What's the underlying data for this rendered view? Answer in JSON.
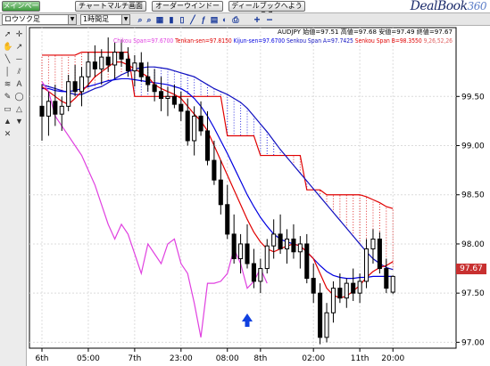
{
  "tabs": [
    {
      "label": "メインページ",
      "active": true
    },
    {
      "label": "チャートマルチ画面",
      "active": false
    },
    {
      "label": "オーダーウインドー",
      "active": false
    },
    {
      "label": "ディールブックへようこそ",
      "active": false
    }
  ],
  "logo": {
    "text": "DealBook",
    "num": "360"
  },
  "toolbar": {
    "chart_type": "ロウソク足",
    "timeframe": "1時間足",
    "icons": [
      "zoom-in-icon",
      "zoom-out-icon",
      "add-icon",
      "remove-icon"
    ]
  },
  "left_tools": [
    "cursor-icon",
    "crosshair-icon",
    "hand-icon",
    "arrow-icon",
    "trendline-icon",
    "hline-icon",
    "vline-icon",
    "channel-icon",
    "fib-icon",
    "text-icon",
    "pencil-icon",
    "ellipse-icon",
    "rect-icon",
    "triangle-icon",
    "arrow-up-icon",
    "arrow-down-icon",
    "delete-icon"
  ],
  "info": {
    "ohlc": "AUDJPY 始値=97.51 高値=97.68 安値=97.49 終値=97.67",
    "chikou": "Chikou Span=97.6700",
    "tenkan": "Tenkan-sen=97.8150",
    "kijun": "Kijun-sen=97.6700",
    "senkou_a": "Senkou Span A=97.7425",
    "senkou_b": "Senkou Span B=98.3550",
    "params": "9,26,52,26"
  },
  "colors": {
    "chikou": "#e040e0",
    "tenkan": "#e00000",
    "kijun": "#0000e0",
    "senkou_a": "#1010c0",
    "senkou_b": "#e00000",
    "price_tag": "#c83030",
    "signal_arrow": "#1040e0"
  },
  "last_price": "97.67",
  "chart_data": {
    "type": "candlestick",
    "symbol": "AUDJPY",
    "ylim": [
      96.94,
      100.2
    ],
    "y_ticks": [
      "97.00",
      "97.50",
      "98.00",
      "98.50",
      "99.00",
      "99.50"
    ],
    "x_ticks": [
      "6th",
      "05:00",
      "7th",
      "23:00",
      "08:00",
      "8th",
      "02:00",
      "11th",
      "20:00"
    ],
    "candles": [
      [
        99.4,
        99.62,
        99.05,
        99.3
      ],
      [
        99.3,
        99.55,
        99.1,
        99.45
      ],
      [
        99.45,
        99.62,
        99.2,
        99.32
      ],
      [
        99.32,
        99.5,
        99.15,
        99.4
      ],
      [
        99.4,
        99.72,
        99.35,
        99.65
      ],
      [
        99.65,
        99.82,
        99.5,
        99.55
      ],
      [
        99.55,
        99.8,
        99.4,
        99.7
      ],
      [
        99.7,
        99.95,
        99.6,
        99.85
      ],
      [
        99.85,
        100.02,
        99.7,
        99.78
      ],
      [
        99.78,
        99.98,
        99.62,
        99.9
      ],
      [
        99.9,
        100.1,
        99.75,
        99.82
      ],
      [
        99.82,
        100.05,
        99.68,
        99.95
      ],
      [
        99.95,
        100.08,
        99.8,
        99.88
      ],
      [
        99.88,
        100.0,
        99.7,
        99.76
      ],
      [
        99.76,
        99.92,
        99.6,
        99.84
      ],
      [
        99.84,
        99.95,
        99.65,
        99.7
      ],
      [
        99.7,
        99.85,
        99.55,
        99.62
      ],
      [
        99.62,
        99.78,
        99.45,
        99.55
      ],
      [
        99.55,
        99.7,
        99.35,
        99.48
      ],
      [
        99.48,
        99.6,
        99.3,
        99.5
      ],
      [
        99.5,
        99.62,
        99.38,
        99.42
      ],
      [
        99.42,
        99.55,
        99.25,
        99.35
      ],
      [
        99.35,
        99.48,
        99.0,
        99.05
      ],
      [
        99.05,
        99.4,
        98.9,
        99.3
      ],
      [
        99.3,
        99.45,
        99.1,
        99.15
      ],
      [
        99.15,
        99.35,
        98.8,
        98.85
      ],
      [
        98.85,
        99.05,
        98.6,
        98.65
      ],
      [
        98.65,
        98.85,
        98.3,
        98.4
      ],
      [
        98.4,
        98.6,
        98.05,
        98.1
      ],
      [
        98.1,
        98.3,
        97.8,
        97.85
      ],
      [
        97.85,
        98.1,
        97.7,
        98.0
      ],
      [
        98.0,
        98.2,
        97.75,
        97.8
      ],
      [
        97.8,
        97.95,
        97.55,
        97.62
      ],
      [
        97.62,
        97.85,
        97.5,
        97.75
      ],
      [
        97.75,
        98.05,
        97.7,
        97.98
      ],
      [
        97.98,
        98.25,
        97.85,
        98.1
      ],
      [
        98.1,
        98.3,
        97.9,
        97.95
      ],
      [
        97.95,
        98.15,
        97.8,
        98.05
      ],
      [
        98.05,
        98.2,
        97.85,
        97.92
      ],
      [
        97.92,
        98.08,
        97.75,
        98.0
      ],
      [
        98.0,
        98.1,
        97.6,
        97.65
      ],
      [
        97.65,
        97.8,
        97.4,
        97.5
      ],
      [
        97.5,
        97.6,
        96.98,
        97.05
      ],
      [
        97.05,
        97.4,
        97.0,
        97.3
      ],
      [
        97.3,
        97.62,
        97.2,
        97.55
      ],
      [
        97.55,
        97.7,
        97.4,
        97.45
      ],
      [
        97.45,
        97.65,
        97.35,
        97.6
      ],
      [
        97.6,
        97.75,
        97.42,
        97.5
      ],
      [
        97.5,
        97.7,
        97.4,
        97.62
      ],
      [
        97.62,
        98.05,
        97.55,
        97.95
      ],
      [
        97.95,
        98.15,
        97.8,
        98.05
      ],
      [
        98.05,
        98.12,
        97.7,
        97.75
      ],
      [
        97.75,
        97.85,
        97.5,
        97.55
      ],
      [
        97.51,
        97.68,
        97.49,
        97.67
      ]
    ],
    "tenkan_sen": [
      99.6,
      99.55,
      99.5,
      99.45,
      99.42,
      99.48,
      99.55,
      99.62,
      99.7,
      99.75,
      99.8,
      99.85,
      99.85,
      99.82,
      99.78,
      99.74,
      99.7,
      99.62,
      99.58,
      99.55,
      99.52,
      99.48,
      99.4,
      99.32,
      99.25,
      99.15,
      99.0,
      98.85,
      98.7,
      98.55,
      98.4,
      98.25,
      98.12,
      98.02,
      97.95,
      97.92,
      97.95,
      97.98,
      98.0,
      97.98,
      97.92,
      97.85,
      97.7,
      97.55,
      97.48,
      97.45,
      97.47,
      97.52,
      97.58,
      97.66,
      97.72,
      97.76,
      97.78,
      97.82
    ],
    "kijun_sen": [
      99.58,
      99.58,
      99.56,
      99.55,
      99.55,
      99.56,
      99.58,
      99.6,
      99.62,
      99.64,
      99.66,
      99.67,
      99.68,
      99.68,
      99.67,
      99.66,
      99.65,
      99.64,
      99.63,
      99.62,
      99.6,
      99.58,
      99.54,
      99.48,
      99.4,
      99.3,
      99.18,
      99.05,
      98.92,
      98.78,
      98.64,
      98.5,
      98.38,
      98.27,
      98.18,
      98.1,
      98.05,
      98.02,
      98.0,
      97.98,
      97.92,
      97.85,
      97.78,
      97.72,
      97.68,
      97.66,
      97.65,
      97.65,
      97.66,
      97.66,
      97.67,
      97.67,
      97.67,
      97.67
    ],
    "senkou_span_a": [
      99.62,
      99.6,
      99.58,
      99.56,
      99.54,
      99.52,
      99.52,
      99.55,
      99.58,
      99.6,
      99.64,
      99.68,
      99.72,
      99.75,
      99.78,
      99.79,
      99.8,
      99.8,
      99.79,
      99.78,
      99.76,
      99.74,
      99.72,
      99.7,
      99.66,
      99.62,
      99.58,
      99.55,
      99.52,
      99.48,
      99.44,
      99.38,
      99.3,
      99.22,
      99.14,
      99.05,
      98.96,
      98.88,
      98.8,
      98.72,
      98.64,
      98.56,
      98.48,
      98.4,
      98.32,
      98.24,
      98.16,
      98.08,
      98.0,
      97.92,
      97.85,
      97.8,
      97.76,
      97.74
    ],
    "senkou_span_b": [
      99.92,
      99.92,
      99.92,
      99.92,
      99.92,
      99.92,
      99.95,
      99.95,
      99.95,
      99.95,
      99.95,
      99.95,
      99.95,
      99.95,
      99.5,
      99.5,
      99.5,
      99.5,
      99.5,
      99.5,
      99.5,
      99.5,
      99.5,
      99.5,
      99.5,
      99.5,
      99.5,
      99.5,
      99.1,
      99.1,
      99.1,
      99.1,
      99.1,
      98.9,
      98.9,
      98.9,
      98.9,
      98.9,
      98.9,
      98.9,
      98.55,
      98.55,
      98.55,
      98.5,
      98.5,
      98.5,
      98.5,
      98.5,
      98.5,
      98.48,
      98.45,
      98.42,
      98.38,
      98.36
    ],
    "chikou_span": [
      99.65,
      99.55,
      99.3,
      99.2,
      99.1,
      99.0,
      98.9,
      98.75,
      98.6,
      98.4,
      98.2,
      98.05,
      98.2,
      98.1,
      97.9,
      97.7,
      98.0,
      97.9,
      97.8,
      98.0,
      98.05,
      97.8,
      97.7,
      97.4,
      97.05,
      97.6,
      97.6,
      97.62,
      97.7,
      97.95,
      97.8,
      97.55,
      97.62,
      97.75,
      97.6
    ],
    "signal_arrow": {
      "direction": "up",
      "index": 31
    }
  }
}
